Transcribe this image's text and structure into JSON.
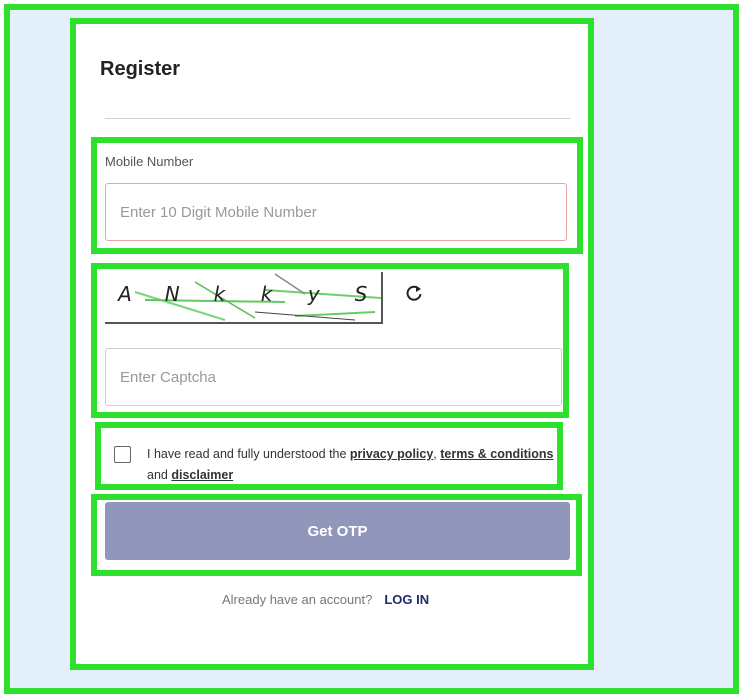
{
  "form": {
    "title": "Register",
    "mobile_label": "Mobile Number",
    "mobile_placeholder": "Enter 10 Digit Mobile Number",
    "captcha_chars": [
      "A",
      "N",
      "k",
      "k",
      "y",
      "S"
    ],
    "captcha_placeholder": "Enter Captcha",
    "refresh_icon": "refresh-icon",
    "terms": {
      "prefix": "I have read and fully understood the ",
      "privacy_policy": "privacy policy",
      "comma": ", ",
      "terms_conditions": "terms & conditions",
      "and": " and ",
      "disclaimer": "disclaimer"
    },
    "submit_label": "Get OTP",
    "account_prompt": "Already have an account?",
    "login_label": "LOG IN"
  },
  "colors": {
    "highlight": "#2ee02e",
    "button": "#9197bb",
    "login_link": "#1f2a6e",
    "page_bg": "#e3f0fc"
  }
}
